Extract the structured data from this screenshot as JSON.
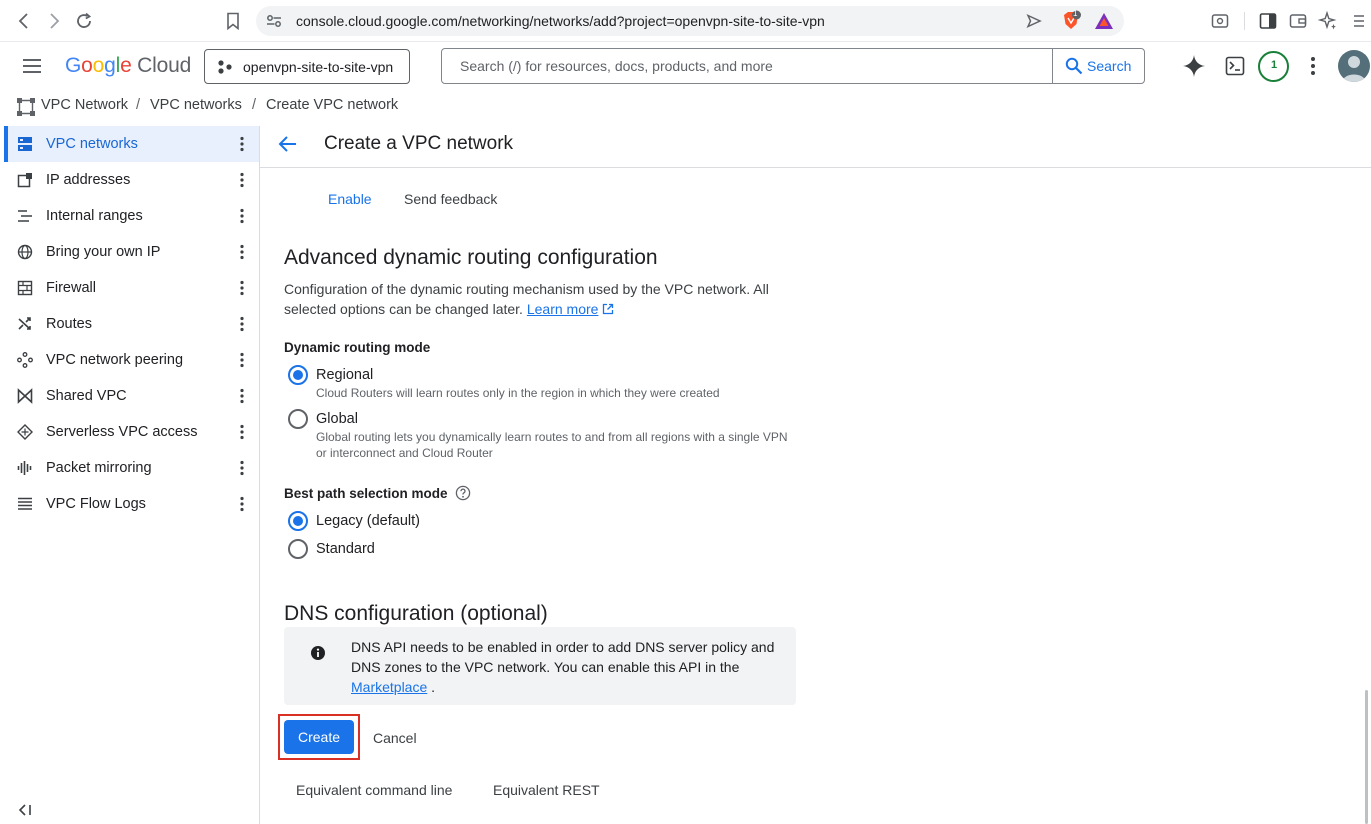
{
  "browser": {
    "url": "console.cloud.google.com/networking/networks/add?project=openvpn-site-to-site-vpn",
    "brave_badge": "1"
  },
  "header": {
    "logo": "Google Cloud",
    "project": "openvpn-site-to-site-vpn",
    "search_placeholder": "Search (/) for resources, docs, products, and more",
    "search_button": "Search",
    "notification_count": "1"
  },
  "breadcrumb": [
    "VPC Network",
    "VPC networks",
    "Create VPC network"
  ],
  "sidebar": {
    "items": [
      {
        "label": "VPC networks",
        "icon": "vpc-networks-icon",
        "active": true
      },
      {
        "label": "IP addresses",
        "icon": "ip-addresses-icon"
      },
      {
        "label": "Internal ranges",
        "icon": "internal-ranges-icon"
      },
      {
        "label": "Bring your own IP",
        "icon": "globe-icon"
      },
      {
        "label": "Firewall",
        "icon": "firewall-icon"
      },
      {
        "label": "Routes",
        "icon": "routes-icon"
      },
      {
        "label": "VPC network peering",
        "icon": "peering-icon"
      },
      {
        "label": "Shared VPC",
        "icon": "shared-vpc-icon"
      },
      {
        "label": "Serverless VPC access",
        "icon": "serverless-icon"
      },
      {
        "label": "Packet mirroring",
        "icon": "packet-mirroring-icon"
      },
      {
        "label": "VPC Flow Logs",
        "icon": "flow-logs-icon"
      }
    ]
  },
  "page": {
    "title": "Create a VPC network",
    "enable_label": "Enable",
    "feedback_label": "Send feedback",
    "adr": {
      "heading": "Advanced dynamic routing configuration",
      "desc": "Configuration of the dynamic routing mechanism used by the VPC network. All selected options can be changed later.",
      "learn_more": "Learn more"
    },
    "routing_mode": {
      "label": "Dynamic routing mode",
      "options": [
        {
          "label": "Regional",
          "desc": "Cloud Routers will learn routes only in the region in which they were created",
          "selected": true
        },
        {
          "label": "Global",
          "desc": "Global routing lets you dynamically learn routes to and from all regions with a single VPN or interconnect and Cloud Router",
          "selected": false
        }
      ]
    },
    "best_path": {
      "label": "Best path selection mode",
      "options": [
        {
          "label": "Legacy (default)",
          "selected": true
        },
        {
          "label": "Standard",
          "selected": false
        }
      ]
    },
    "dns": {
      "heading": "DNS configuration (optional)",
      "info": "DNS API needs to be enabled in order to add DNS server policy and DNS zones to the VPC network. You can enable this API in the",
      "marketplace": "Marketplace",
      "period": "."
    },
    "create_label": "Create",
    "cancel_label": "Cancel",
    "cmdline_label": "Equivalent command line",
    "rest_label": "Equivalent REST"
  },
  "colors": {
    "accent": "#1a73e8",
    "highlight": "#d93025"
  }
}
